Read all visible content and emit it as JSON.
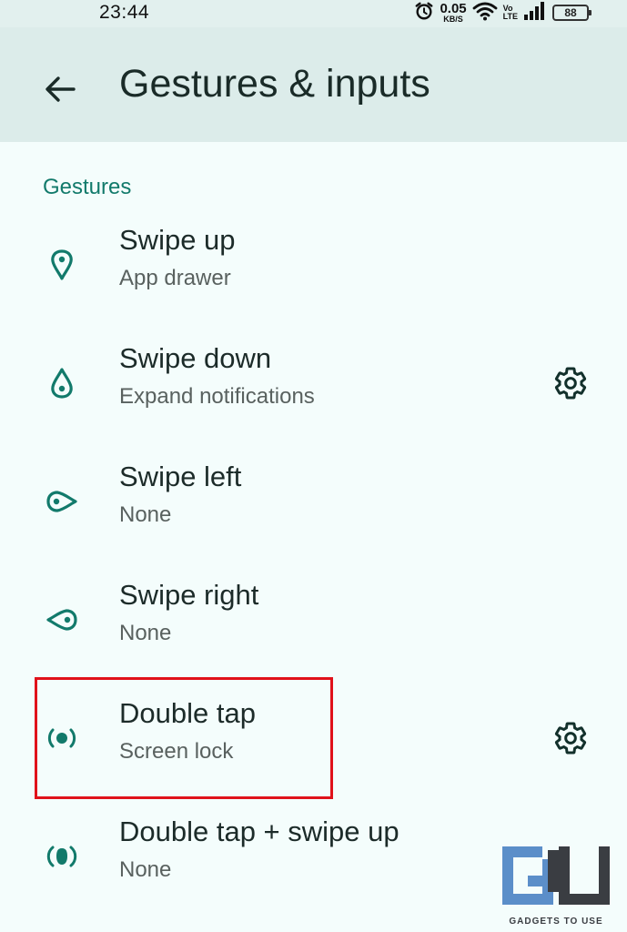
{
  "status_bar": {
    "time": "23:44",
    "net_speed": "0.05",
    "net_speed_unit": "KB/S",
    "volte_top": "Vo",
    "volte_bottom": "LTE",
    "battery": "88"
  },
  "app_bar": {
    "title": "Gestures & inputs"
  },
  "section": {
    "header": "Gestures"
  },
  "items": [
    {
      "title": "Swipe up",
      "subtitle": "App drawer",
      "icon": "swipe-up-icon",
      "has_settings": false
    },
    {
      "title": "Swipe down",
      "subtitle": "Expand notifications",
      "icon": "swipe-down-icon",
      "has_settings": true
    },
    {
      "title": "Swipe left",
      "subtitle": "None",
      "icon": "swipe-left-icon",
      "has_settings": false
    },
    {
      "title": "Swipe right",
      "subtitle": "None",
      "icon": "swipe-right-icon",
      "has_settings": false
    },
    {
      "title": "Double tap",
      "subtitle": "Screen lock",
      "icon": "double-tap-icon",
      "has_settings": true
    },
    {
      "title": "Double tap + swipe up",
      "subtitle": "None",
      "icon": "double-tap-swipe-up-icon",
      "has_settings": false
    }
  ],
  "watermark": {
    "text": "GADGETS TO USE"
  },
  "colors": {
    "accent": "#127a6b",
    "app_bar": "#dcecea",
    "background": "#f4fdfc",
    "highlight": "#e0121a"
  }
}
